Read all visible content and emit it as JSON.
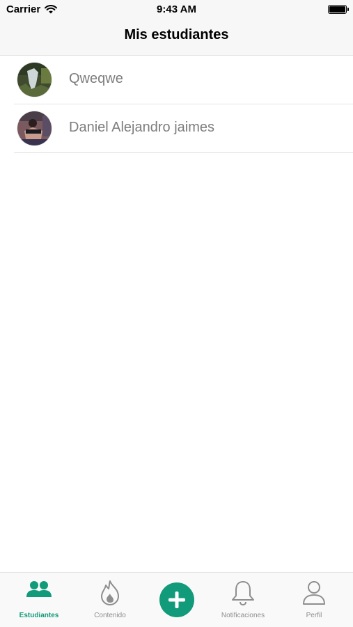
{
  "status_bar": {
    "carrier": "Carrier",
    "time": "9:43 AM"
  },
  "header": {
    "title": "Mis estudiantes"
  },
  "students": [
    {
      "name": "Qweqwe"
    },
    {
      "name": "Daniel Alejandro jaimes"
    }
  ],
  "tabbar": {
    "tabs": [
      {
        "label": "Estudiantes",
        "icon": "people-icon",
        "active": true
      },
      {
        "label": "Contenido",
        "icon": "flame-icon",
        "active": false
      },
      {
        "label": "",
        "icon": "plus-icon",
        "active": false
      },
      {
        "label": "Notificaciones",
        "icon": "bell-icon",
        "active": false
      },
      {
        "label": "Perfil",
        "icon": "person-icon",
        "active": false
      }
    ],
    "accent_color": "#129b7a",
    "inactive_color": "#8e8e8e"
  }
}
